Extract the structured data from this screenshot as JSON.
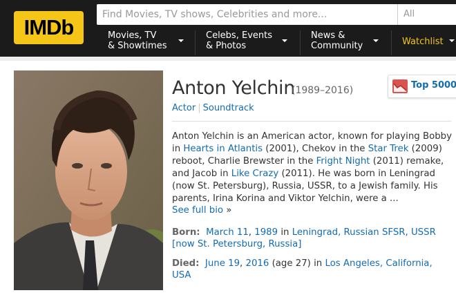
{
  "header": {
    "logo": "IMDb",
    "search_placeholder": "Find Movies, TV shows, Celebrities and more...",
    "search_category": "All",
    "nav": [
      {
        "line1": "Movies, TV",
        "line2": "& Showtimes"
      },
      {
        "line1": "Celebs, Events",
        "line2": "& Photos"
      },
      {
        "line1": "News &",
        "line2": "Community"
      }
    ],
    "watchlist": "Watchlist"
  },
  "person": {
    "name": "Anton Yelchin",
    "years": "(1989–2016)",
    "roles": [
      "Actor",
      "Soundtrack"
    ]
  },
  "badge": {
    "label": "Top 5000",
    "icon": "trend-chart-icon"
  },
  "bio": {
    "p1": "Anton Yelchin is an American actor, known for playing Bobby in ",
    "l1": "Hearts in Atlantis",
    "p2": " (2001), Chekov in the ",
    "l2": "Star Trek",
    "p3": " (2009) reboot, Charlie Brewster in the ",
    "l3": "Fright Night",
    "p4": " (2011) remake, and Jacob in ",
    "l4": "Like Crazy",
    "p5": " (2011). He was born in Leningrad (now St. Petersburg), Russia, USSR, to a Jewish family. His parents, Irina Korina and Viktor Yelchin, were a ...",
    "see_full": "See full bio",
    "raquo": "»"
  },
  "born": {
    "label": "Born:",
    "date": "March 11",
    "comma": ",",
    "year": "1989",
    "in": "in",
    "place": "Leningrad, Russian SFSR, USSR [now St. Petersburg, Russia]"
  },
  "died": {
    "label": "Died:",
    "date": "June 19",
    "comma": ",",
    "year": "2016",
    "age": "(age 27) in",
    "place": "Los Angeles, California, USA"
  },
  "colors": {
    "brand": "#f5c518",
    "header_bg": "#1b1b1b",
    "link": "#136cb2"
  }
}
